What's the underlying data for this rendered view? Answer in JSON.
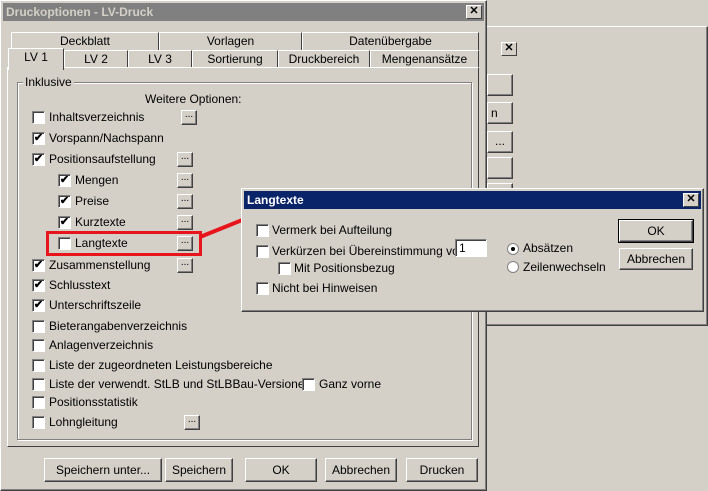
{
  "main": {
    "title": "Druckoptionen - LV-Druck",
    "tabs_row1": [
      "Deckblatt",
      "Vorlagen",
      "Datenübergabe"
    ],
    "tabs_row2": [
      "LV 1",
      "LV 2",
      "LV 3",
      "Sortierung",
      "Druckbereich",
      "Mengenansätze"
    ],
    "group_label": "Inklusive",
    "more_options": "Weitere Optionen:",
    "items": [
      {
        "label": "Inhaltsverzeichnis",
        "checked": false
      },
      {
        "label": "Vorspann/Nachspann",
        "checked": true
      },
      {
        "label": "Positionsaufstellung",
        "checked": true
      },
      {
        "label": "Mengen",
        "checked": true
      },
      {
        "label": "Preise",
        "checked": true
      },
      {
        "label": "Kurztexte",
        "checked": true
      },
      {
        "label": "Langtexte",
        "checked": false
      },
      {
        "label": "Zusammenstellung",
        "checked": true
      },
      {
        "label": "Schlusstext",
        "checked": true
      },
      {
        "label": "Unterschriftszeile",
        "checked": true
      },
      {
        "label": "Bieterangabenverzeichnis",
        "checked": false
      },
      {
        "label": "Anlagenverzeichnis",
        "checked": false
      },
      {
        "label": "Liste der zugeordneten Leistungsbereiche",
        "checked": false
      },
      {
        "label": "Liste der verwendt. StLB und StLBBau-Versionen",
        "checked": false
      },
      {
        "label": "Positionsstatistik",
        "checked": false
      },
      {
        "label": "Lohngleitung",
        "checked": false
      }
    ],
    "ganz_vorne": "Ganz vorne",
    "dots": "...",
    "buttons": [
      "Speichern unter...",
      "Speichern",
      "OK",
      "Abbrechen",
      "Drucken"
    ]
  },
  "bg": {
    "btn_labels": [
      "n",
      "..."
    ],
    "close": "✕"
  },
  "dialog": {
    "title": "Langtexte",
    "close": "✕",
    "vermerk": "Vermerk bei Aufteilung",
    "verkuerzen": "Verkürzen bei Übereinstimmung von",
    "verkuerzen_value": "1",
    "mit_pos": "Mit Positionsbezug",
    "nicht_hinweisen": "Nicht bei Hinweisen",
    "absaetzen": "Absätzen",
    "zeilenwechseln": "Zeilenwechseln",
    "ok": "OK",
    "abbrechen": "Abbrechen"
  },
  "colors": {
    "highlight": "#e8141c",
    "active_title": "#0a246a",
    "inactive_title": "#808080"
  }
}
